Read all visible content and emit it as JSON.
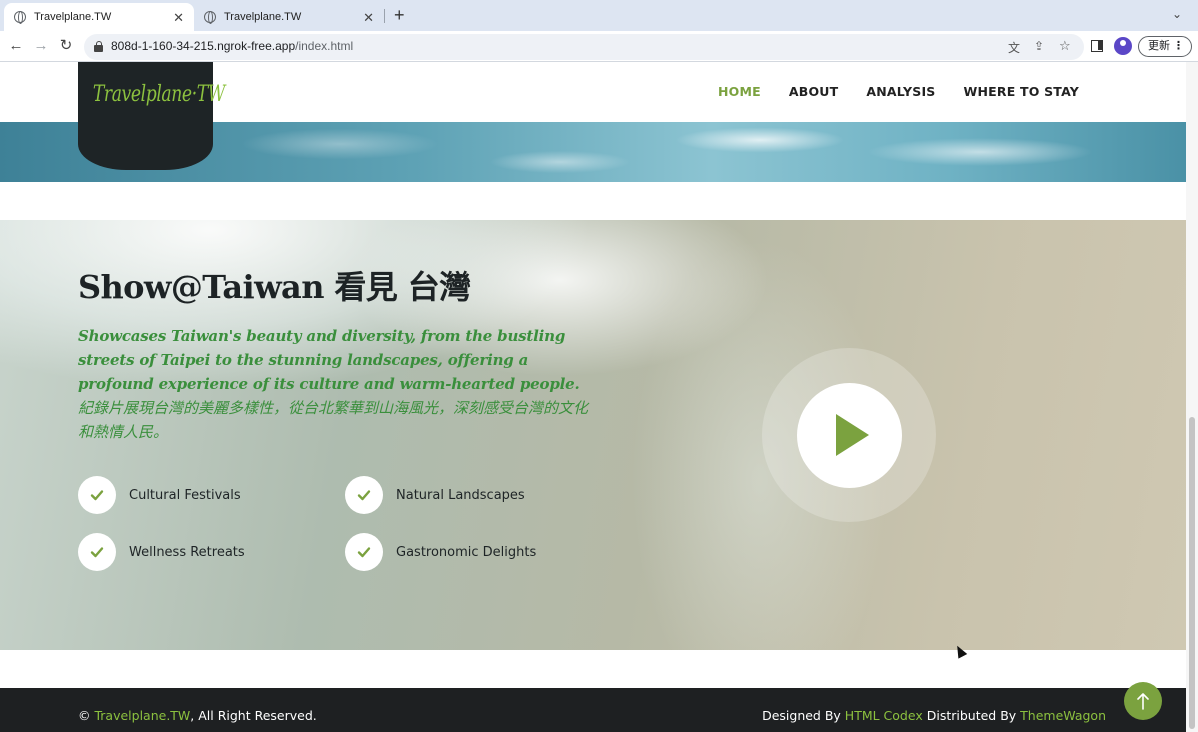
{
  "browser": {
    "tabs": [
      {
        "title": "Travelplane.TW",
        "active": true
      },
      {
        "title": "Travelplane.TW",
        "active": false
      }
    ],
    "url_host": "808d-1-160-34-215.ngrok-free.app",
    "url_path": "/index.html",
    "update_label": "更新"
  },
  "site": {
    "logo": "Travelplane·TW",
    "nav": [
      "HOME",
      "ABOUT",
      "ANALYSIS",
      "WHERE TO STAY"
    ],
    "active_nav": "HOME"
  },
  "hero": {
    "title": "Show@Taiwan 看見 台灣",
    "description_en": "Showcases Taiwan's beauty and diversity, from the bustling streets of Taipei to the stunning landscapes, offering a profound experience of its culture and warm-hearted people.",
    "description_zh": "紀錄片展現台灣的美麗多樣性，從台北繁華到山海風光，深刻感受台灣的文化和熱情人民。",
    "features": [
      "Cultural Festivals",
      "Natural Landscapes",
      "Wellness Retreats",
      "Gastronomic Delights"
    ]
  },
  "footer": {
    "copyright_symbol": "©",
    "brand": "Travelplane.TW",
    "rights": ", All Right Reserved.",
    "designed_by": "Designed By",
    "designer": "HTML Codex",
    "distributed_by": "Distributed By",
    "distributor": "ThemeWagon"
  },
  "colors": {
    "accent": "#7ba23f",
    "dark": "#1e2426",
    "hero_text_green": "#3a8f3c"
  },
  "icons": [
    "globe-icon",
    "close-icon",
    "plus-icon",
    "back-icon",
    "forward-icon",
    "reload-icon",
    "lock-icon",
    "translate-icon",
    "share-icon",
    "star-icon",
    "side-panel-icon",
    "profile-icon",
    "check-icon",
    "play-icon",
    "arrow-up-icon"
  ]
}
